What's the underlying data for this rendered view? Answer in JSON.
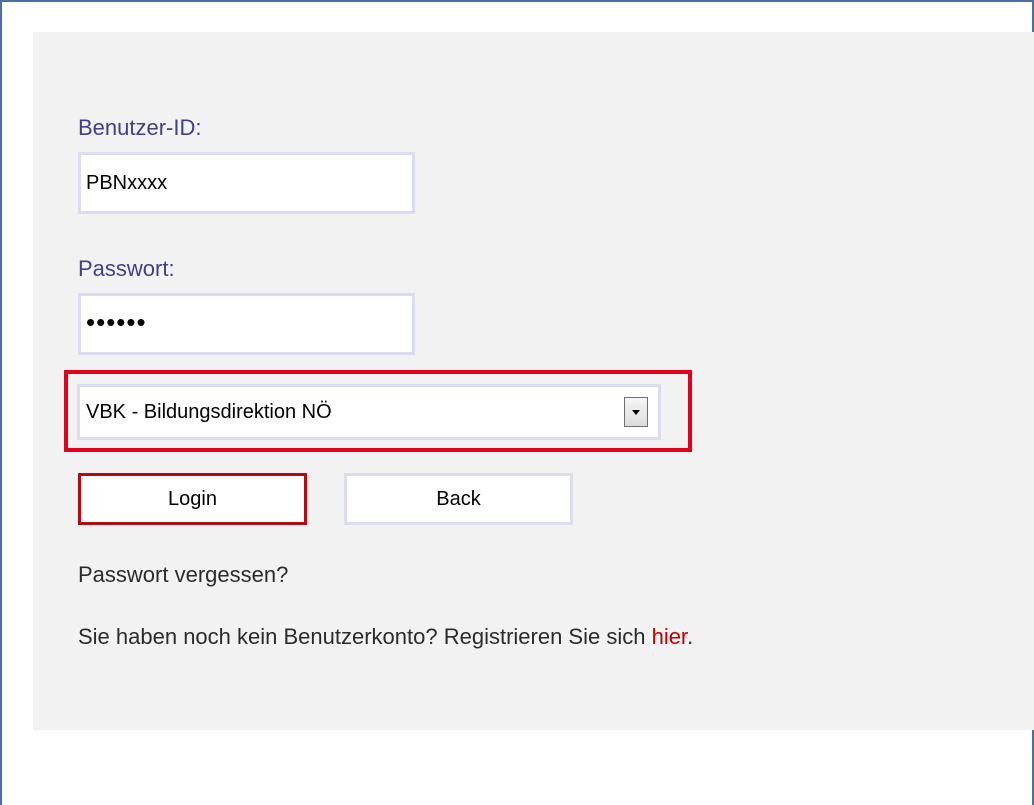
{
  "login_form": {
    "userid_label": "Benutzer-ID:",
    "userid_value": "PBNxxxx",
    "password_label": "Passwort:",
    "password_value": "••••••",
    "institution_select": "VBK - Bildungsdirektion NÖ",
    "login_button": "Login",
    "back_button": "Back",
    "forgot_password": "Passwort vergessen?",
    "register_text": "Sie haben noch kein Benutzerkonto? Registrieren Sie sich ",
    "register_link": "hier",
    "register_suffix": "."
  },
  "colors": {
    "label": "#3f3f8f",
    "highlight_border": "#e2001a",
    "login_border": "#b40a14",
    "link": "#c00000",
    "panel_bg": "#f2f2f2"
  },
  "icons": {
    "dropdown": "chevron-down-icon"
  }
}
